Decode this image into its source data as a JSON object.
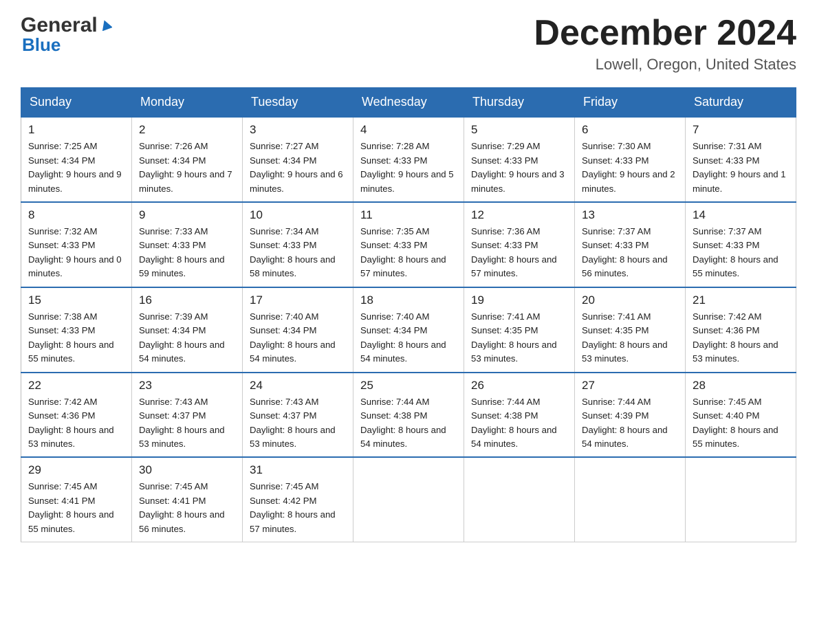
{
  "logo": {
    "name_part1": "General",
    "name_part2": "Blue"
  },
  "header": {
    "month_year": "December 2024",
    "location": "Lowell, Oregon, United States"
  },
  "days_of_week": [
    "Sunday",
    "Monday",
    "Tuesday",
    "Wednesday",
    "Thursday",
    "Friday",
    "Saturday"
  ],
  "weeks": [
    [
      {
        "day": "1",
        "sunrise": "Sunrise: 7:25 AM",
        "sunset": "Sunset: 4:34 PM",
        "daylight": "Daylight: 9 hours and 9 minutes."
      },
      {
        "day": "2",
        "sunrise": "Sunrise: 7:26 AM",
        "sunset": "Sunset: 4:34 PM",
        "daylight": "Daylight: 9 hours and 7 minutes."
      },
      {
        "day": "3",
        "sunrise": "Sunrise: 7:27 AM",
        "sunset": "Sunset: 4:34 PM",
        "daylight": "Daylight: 9 hours and 6 minutes."
      },
      {
        "day": "4",
        "sunrise": "Sunrise: 7:28 AM",
        "sunset": "Sunset: 4:33 PM",
        "daylight": "Daylight: 9 hours and 5 minutes."
      },
      {
        "day": "5",
        "sunrise": "Sunrise: 7:29 AM",
        "sunset": "Sunset: 4:33 PM",
        "daylight": "Daylight: 9 hours and 3 minutes."
      },
      {
        "day": "6",
        "sunrise": "Sunrise: 7:30 AM",
        "sunset": "Sunset: 4:33 PM",
        "daylight": "Daylight: 9 hours and 2 minutes."
      },
      {
        "day": "7",
        "sunrise": "Sunrise: 7:31 AM",
        "sunset": "Sunset: 4:33 PM",
        "daylight": "Daylight: 9 hours and 1 minute."
      }
    ],
    [
      {
        "day": "8",
        "sunrise": "Sunrise: 7:32 AM",
        "sunset": "Sunset: 4:33 PM",
        "daylight": "Daylight: 9 hours and 0 minutes."
      },
      {
        "day": "9",
        "sunrise": "Sunrise: 7:33 AM",
        "sunset": "Sunset: 4:33 PM",
        "daylight": "Daylight: 8 hours and 59 minutes."
      },
      {
        "day": "10",
        "sunrise": "Sunrise: 7:34 AM",
        "sunset": "Sunset: 4:33 PM",
        "daylight": "Daylight: 8 hours and 58 minutes."
      },
      {
        "day": "11",
        "sunrise": "Sunrise: 7:35 AM",
        "sunset": "Sunset: 4:33 PM",
        "daylight": "Daylight: 8 hours and 57 minutes."
      },
      {
        "day": "12",
        "sunrise": "Sunrise: 7:36 AM",
        "sunset": "Sunset: 4:33 PM",
        "daylight": "Daylight: 8 hours and 57 minutes."
      },
      {
        "day": "13",
        "sunrise": "Sunrise: 7:37 AM",
        "sunset": "Sunset: 4:33 PM",
        "daylight": "Daylight: 8 hours and 56 minutes."
      },
      {
        "day": "14",
        "sunrise": "Sunrise: 7:37 AM",
        "sunset": "Sunset: 4:33 PM",
        "daylight": "Daylight: 8 hours and 55 minutes."
      }
    ],
    [
      {
        "day": "15",
        "sunrise": "Sunrise: 7:38 AM",
        "sunset": "Sunset: 4:33 PM",
        "daylight": "Daylight: 8 hours and 55 minutes."
      },
      {
        "day": "16",
        "sunrise": "Sunrise: 7:39 AM",
        "sunset": "Sunset: 4:34 PM",
        "daylight": "Daylight: 8 hours and 54 minutes."
      },
      {
        "day": "17",
        "sunrise": "Sunrise: 7:40 AM",
        "sunset": "Sunset: 4:34 PM",
        "daylight": "Daylight: 8 hours and 54 minutes."
      },
      {
        "day": "18",
        "sunrise": "Sunrise: 7:40 AM",
        "sunset": "Sunset: 4:34 PM",
        "daylight": "Daylight: 8 hours and 54 minutes."
      },
      {
        "day": "19",
        "sunrise": "Sunrise: 7:41 AM",
        "sunset": "Sunset: 4:35 PM",
        "daylight": "Daylight: 8 hours and 53 minutes."
      },
      {
        "day": "20",
        "sunrise": "Sunrise: 7:41 AM",
        "sunset": "Sunset: 4:35 PM",
        "daylight": "Daylight: 8 hours and 53 minutes."
      },
      {
        "day": "21",
        "sunrise": "Sunrise: 7:42 AM",
        "sunset": "Sunset: 4:36 PM",
        "daylight": "Daylight: 8 hours and 53 minutes."
      }
    ],
    [
      {
        "day": "22",
        "sunrise": "Sunrise: 7:42 AM",
        "sunset": "Sunset: 4:36 PM",
        "daylight": "Daylight: 8 hours and 53 minutes."
      },
      {
        "day": "23",
        "sunrise": "Sunrise: 7:43 AM",
        "sunset": "Sunset: 4:37 PM",
        "daylight": "Daylight: 8 hours and 53 minutes."
      },
      {
        "day": "24",
        "sunrise": "Sunrise: 7:43 AM",
        "sunset": "Sunset: 4:37 PM",
        "daylight": "Daylight: 8 hours and 53 minutes."
      },
      {
        "day": "25",
        "sunrise": "Sunrise: 7:44 AM",
        "sunset": "Sunset: 4:38 PM",
        "daylight": "Daylight: 8 hours and 54 minutes."
      },
      {
        "day": "26",
        "sunrise": "Sunrise: 7:44 AM",
        "sunset": "Sunset: 4:38 PM",
        "daylight": "Daylight: 8 hours and 54 minutes."
      },
      {
        "day": "27",
        "sunrise": "Sunrise: 7:44 AM",
        "sunset": "Sunset: 4:39 PM",
        "daylight": "Daylight: 8 hours and 54 minutes."
      },
      {
        "day": "28",
        "sunrise": "Sunrise: 7:45 AM",
        "sunset": "Sunset: 4:40 PM",
        "daylight": "Daylight: 8 hours and 55 minutes."
      }
    ],
    [
      {
        "day": "29",
        "sunrise": "Sunrise: 7:45 AM",
        "sunset": "Sunset: 4:41 PM",
        "daylight": "Daylight: 8 hours and 55 minutes."
      },
      {
        "day": "30",
        "sunrise": "Sunrise: 7:45 AM",
        "sunset": "Sunset: 4:41 PM",
        "daylight": "Daylight: 8 hours and 56 minutes."
      },
      {
        "day": "31",
        "sunrise": "Sunrise: 7:45 AM",
        "sunset": "Sunset: 4:42 PM",
        "daylight": "Daylight: 8 hours and 57 minutes."
      },
      null,
      null,
      null,
      null
    ]
  ]
}
